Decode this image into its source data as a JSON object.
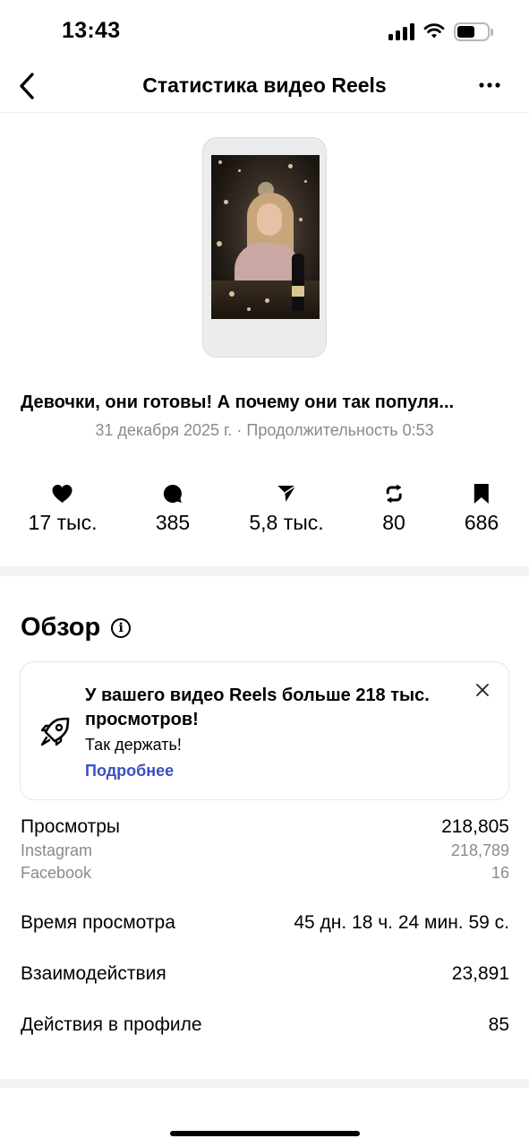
{
  "status_bar": {
    "time": "13:43",
    "battery_level": 0.6
  },
  "header": {
    "title": "Статистика видео Reels",
    "back_icon": "chevron-left-icon",
    "more_icon": "more-horizontal-icon"
  },
  "reel": {
    "title": "Девочки, они готовы! А почему они так популя...",
    "meta": "31 декабря 2025 г. · Продолжительность 0:53"
  },
  "stats": [
    {
      "icon": "heart-icon",
      "value": "17 тыс."
    },
    {
      "icon": "comment-icon",
      "value": "385"
    },
    {
      "icon": "share-icon",
      "value": "5,8 тыс."
    },
    {
      "icon": "repost-icon",
      "value": "80"
    },
    {
      "icon": "bookmark-icon",
      "value": "686"
    }
  ],
  "overview": {
    "title": "Обзор",
    "info_icon": "info-icon",
    "banner": {
      "icon": "rocket-icon",
      "heading": "У вашего видео Reels больше 218 тыс. просмотров!",
      "subtext": "Так держать!",
      "link": "Подробнее",
      "close_icon": "close-icon"
    },
    "views": {
      "label": "Просмотры",
      "value": "218,805"
    },
    "views_breakdown": [
      {
        "label": "Instagram",
        "value": "218,789"
      },
      {
        "label": "Facebook",
        "value": "16"
      }
    ],
    "watch_time": {
      "label": "Время просмотра",
      "value": "45 дн. 18 ч. 24 мин. 59 с."
    },
    "interactions": {
      "label": "Взаимодействия",
      "value": "23,891"
    },
    "profile_actions": {
      "label": "Действия в профиле",
      "value": "85"
    }
  },
  "colors": {
    "accent_link": "#3b4fc4",
    "secondary_text": "#8a8a8a",
    "divider": "#f3f3f3"
  }
}
